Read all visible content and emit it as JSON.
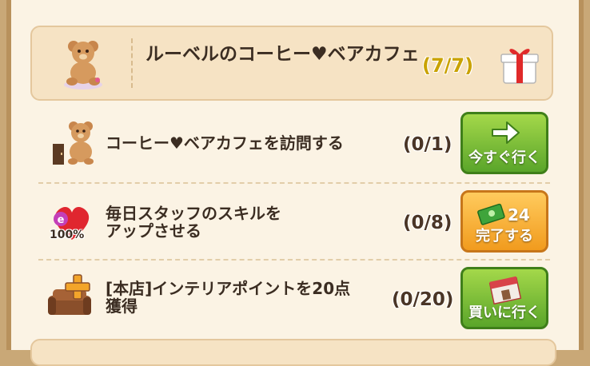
{
  "colors": {
    "panel_bg": "#fbf3e4",
    "header_bg": "#f6e3c4",
    "green_button": "#5aa52a",
    "orange_button": "#f19b1e",
    "header_count_color": "#c9a200"
  },
  "header": {
    "title": "ルーベルのコーヒー♥ベアカフェ",
    "progress": "(7/7)",
    "icons": [
      "teddy-bear-icon",
      "gift-box-icon"
    ]
  },
  "tasks": [
    {
      "label": "コーヒー♥ベアカフェを訪問する",
      "progress": "(0/1)",
      "button_label": "今すぐ行く",
      "button_icon": "arrow-right-icon",
      "icon": "teddy-bear-door-icon"
    },
    {
      "label_line1": "毎日スタッフのスキルを",
      "label_line2": "アップさせる",
      "progress": "(0/8)",
      "button_label": "完了する",
      "button_reward": "24",
      "button_icon": "cash-icon",
      "icon": "heart-energy-icon",
      "icon_badge": "100%"
    },
    {
      "label_line1": "[本店]インテリアポイントを20点",
      "label_line2": "獲得",
      "progress": "(0/20)",
      "button_label": "買いに行く",
      "button_icon": "shop-icon",
      "icon": "sofa-plus-icon"
    }
  ]
}
